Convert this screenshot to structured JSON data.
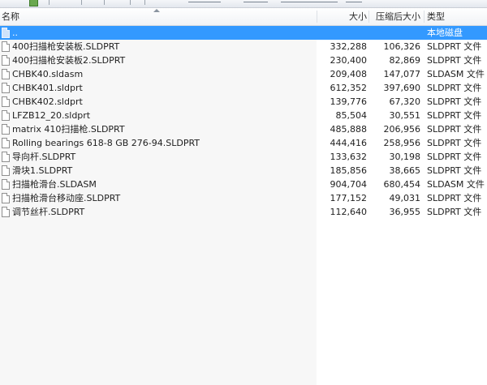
{
  "header": {
    "name": "名称",
    "size": "大小",
    "compressed": "压缩后大小",
    "type": "类型"
  },
  "rows": [
    {
      "name": "..",
      "size": "",
      "compressed": "",
      "type": "本地磁盘",
      "selected": true
    },
    {
      "name": "400扫描枪安装板.SLDPRT",
      "size": "332,288",
      "compressed": "106,326",
      "type": "SLDPRT 文件"
    },
    {
      "name": "400扫描枪安装板2.SLDPRT",
      "size": "230,400",
      "compressed": "82,869",
      "type": "SLDPRT 文件"
    },
    {
      "name": "CHBK40.sldasm",
      "size": "209,408",
      "compressed": "147,077",
      "type": "SLDASM 文件"
    },
    {
      "name": "CHBK401.sldprt",
      "size": "612,352",
      "compressed": "397,690",
      "type": "SLDPRT 文件"
    },
    {
      "name": "CHBK402.sldprt",
      "size": "139,776",
      "compressed": "67,320",
      "type": "SLDPRT 文件"
    },
    {
      "name": "LFZB12_20.sldprt",
      "size": "85,504",
      "compressed": "30,551",
      "type": "SLDPRT 文件"
    },
    {
      "name": "matrix 410扫描枪.SLDPRT",
      "size": "485,888",
      "compressed": "206,956",
      "type": "SLDPRT 文件"
    },
    {
      "name": "Rolling bearings 618-8 GB 276-94.SLDPRT",
      "size": "444,416",
      "compressed": "258,956",
      "type": "SLDPRT 文件"
    },
    {
      "name": "导向杆.SLDPRT",
      "size": "133,632",
      "compressed": "30,198",
      "type": "SLDPRT 文件"
    },
    {
      "name": "滑块1.SLDPRT",
      "size": "185,856",
      "compressed": "38,665",
      "type": "SLDPRT 文件"
    },
    {
      "name": "扫描枪滑台.SLDASM",
      "size": "904,704",
      "compressed": "680,454",
      "type": "SLDASM 文件"
    },
    {
      "name": "扫描枪滑台移动座.SLDPRT",
      "size": "177,152",
      "compressed": "49,031",
      "type": "SLDPRT 文件"
    },
    {
      "name": "调节丝杆.SLDPRT",
      "size": "112,640",
      "compressed": "36,955",
      "type": "SLDPRT 文件"
    }
  ]
}
